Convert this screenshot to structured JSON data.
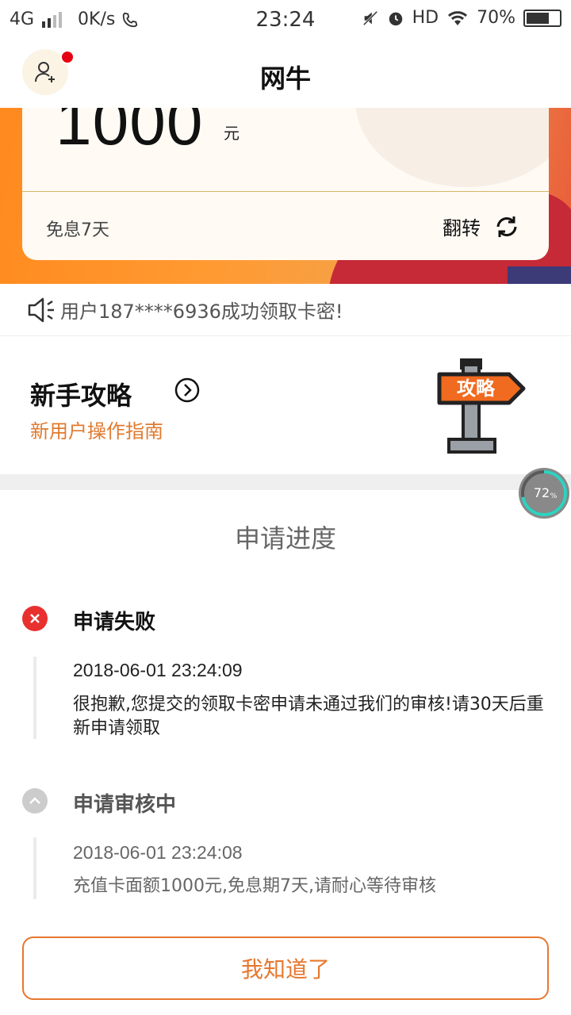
{
  "status_bar": {
    "network": "4G",
    "speed": "0K/s",
    "time": "23:24",
    "hd": "HD",
    "battery": "70%",
    "battery_level": 0.7
  },
  "header": {
    "title": "网牛"
  },
  "card": {
    "amount": "1000",
    "unit": "元",
    "interest": "免息7天",
    "flip_label": "翻转"
  },
  "notice": {
    "text": "用户187****6936成功领取卡密!"
  },
  "guide": {
    "title": "新手攻略",
    "subtitle": "新用户操作指南",
    "sign_text": "攻略"
  },
  "float_progress": {
    "label": "72",
    "unit": "%",
    "value": 0.72
  },
  "progress": {
    "title": "申请进度",
    "steps": [
      {
        "status": "申请失败",
        "time": "2018-06-01 23:24:09",
        "message": "很抱歉,您提交的领取卡密申请未通过我们的审核!请30天后重新申请领取"
      },
      {
        "status": "申请审核中",
        "time": "2018-06-01 23:24:08",
        "message": "充值卡面额1000元,免息期7天,请耐心等待审核"
      }
    ]
  },
  "ack_button": {
    "label": "我知道了"
  },
  "colors": {
    "accent": "#e8772e",
    "error": "#e8302f",
    "pending": "#cccccc",
    "banner": "#ff8a1e"
  }
}
